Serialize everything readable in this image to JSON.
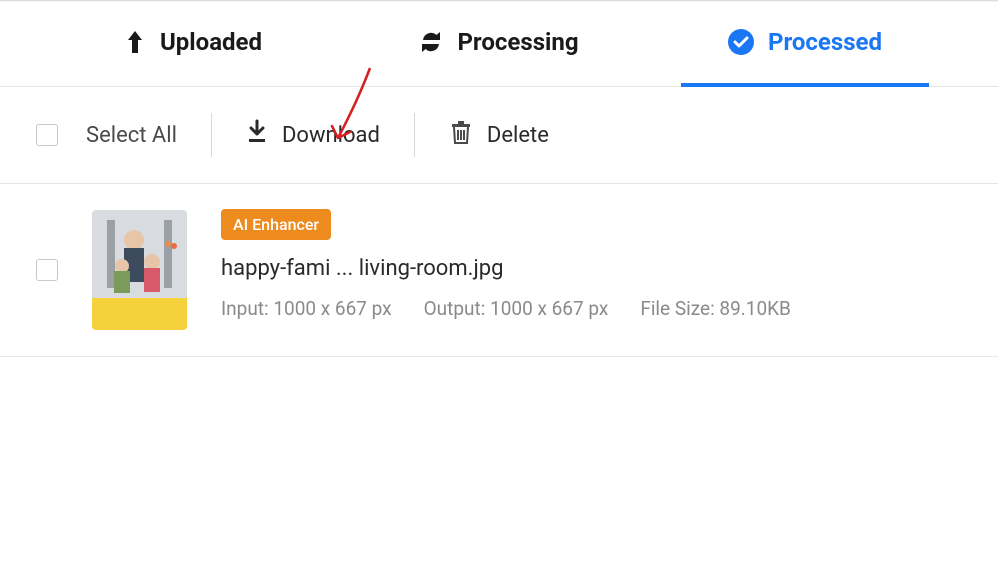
{
  "tabs": {
    "uploaded": "Uploaded",
    "processing": "Processing",
    "processed": "Processed"
  },
  "toolbar": {
    "select_all": "Select All",
    "download": "Download",
    "delete": "Delete"
  },
  "item": {
    "badge": "AI Enhancer",
    "filename": "happy-fami ... living-room.jpg",
    "input": "Input: 1000 x 667 px",
    "output": "Output: 1000 x 667 px",
    "filesize": "File Size: 89.10KB"
  }
}
